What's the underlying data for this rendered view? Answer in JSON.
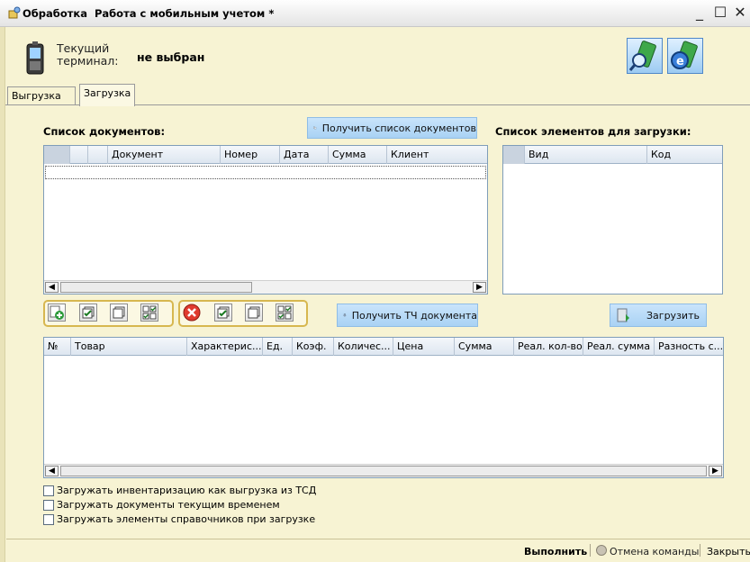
{
  "window": {
    "title": "Обработка  Работа с мобильным учетом *",
    "minimize": "_",
    "maximize": "☐",
    "close": "✕"
  },
  "terminal": {
    "label": "Текущий\nтерминал:",
    "value": "не выбран"
  },
  "tabs": [
    {
      "label": "Выгрузка",
      "active": false
    },
    {
      "label": "Загрузка",
      "active": true
    }
  ],
  "documents": {
    "title": "Список документов:",
    "get_list_button": "Получить список документов",
    "columns": [
      "",
      "",
      "Документ",
      "Номер",
      "Дата",
      "Сумма",
      "Клиент"
    ],
    "rows": []
  },
  "elements": {
    "title": "Список элементов для загрузки:",
    "columns": [
      "",
      "Вид",
      "Код"
    ],
    "rows": []
  },
  "toolbar": {
    "get_tc_button": "Получить ТЧ документа",
    "load_button": "Загрузить"
  },
  "items_table": {
    "columns": [
      "№",
      "Товар",
      "Характерис...",
      "Ед.",
      "Коэф.",
      "Количес...",
      "Цена",
      "Сумма",
      "Реал. кол-во",
      "Реал. сумма",
      "Разность с..."
    ],
    "rows": []
  },
  "options": [
    {
      "label": "Загружать инвентаризацию как выгрузка из ТСД",
      "checked": false
    },
    {
      "label": "Загружать документы текущим временем",
      "checked": false
    },
    {
      "label": "Загружать элементы справочников при загрузке",
      "checked": false
    }
  ],
  "footer": {
    "execute": "Выполнить",
    "cancel": "Отмена команды",
    "close": "Закрыть"
  }
}
